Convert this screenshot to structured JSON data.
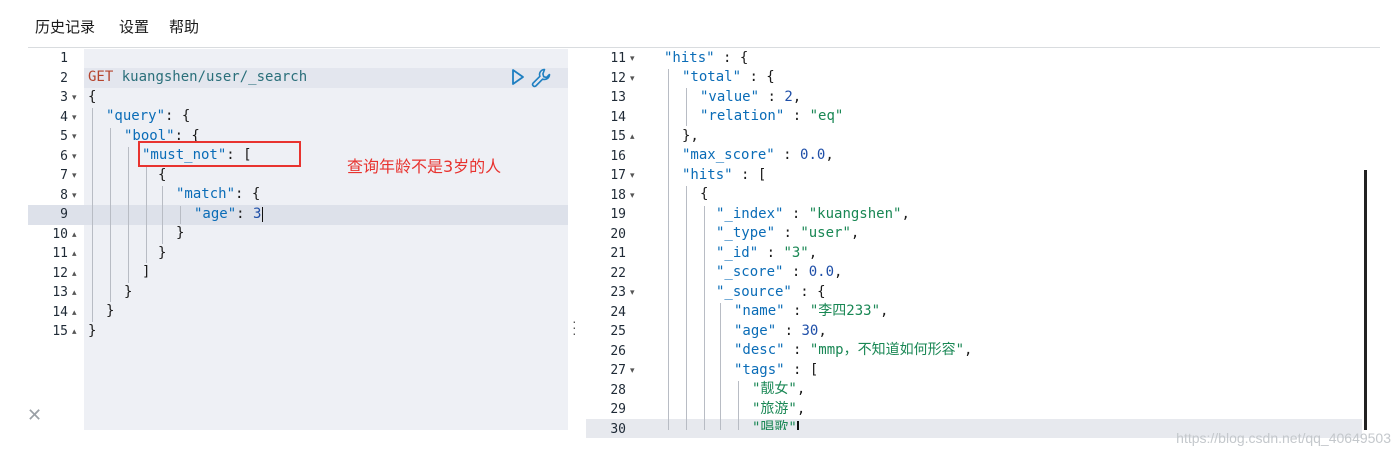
{
  "menu": {
    "history": "历史记录",
    "settings": "设置",
    "help": "帮助"
  },
  "request": {
    "lines": [
      {
        "n": "1",
        "fold": ""
      },
      {
        "n": "2",
        "fold": ""
      },
      {
        "n": "3",
        "fold": "▾"
      },
      {
        "n": "4",
        "fold": "▾"
      },
      {
        "n": "5",
        "fold": "▾"
      },
      {
        "n": "6",
        "fold": "▾"
      },
      {
        "n": "7",
        "fold": "▾"
      },
      {
        "n": "8",
        "fold": "▾"
      },
      {
        "n": "9",
        "fold": ""
      },
      {
        "n": "10",
        "fold": "▴"
      },
      {
        "n": "11",
        "fold": "▴"
      },
      {
        "n": "12",
        "fold": "▴"
      },
      {
        "n": "13",
        "fold": "▴"
      },
      {
        "n": "14",
        "fold": "▴"
      },
      {
        "n": "15",
        "fold": "▴"
      }
    ],
    "method": "GET",
    "path": "kuangshen/user/_search",
    "t3": "{",
    "t4_key": "\"query\"",
    "t4_rest": ": {",
    "t5_key": "\"bool\"",
    "t5_rest": ": {",
    "t6_key": "\"must_not\"",
    "t6_rest": ": [",
    "t7": "{",
    "t8_key": "\"match\"",
    "t8_rest": ": {",
    "t9_key": "\"age\"",
    "t9_sep": ": ",
    "t9_val": "3",
    "t10": "}",
    "t11": "}",
    "t12": "]",
    "t13": "}",
    "t14": "}",
    "t15": "}"
  },
  "annotation": "查询年龄不是3岁的人",
  "response": {
    "lines": [
      {
        "n": "11",
        "fold": "▾"
      },
      {
        "n": "12",
        "fold": "▾"
      },
      {
        "n": "13",
        "fold": ""
      },
      {
        "n": "14",
        "fold": ""
      },
      {
        "n": "15",
        "fold": "▴"
      },
      {
        "n": "16",
        "fold": ""
      },
      {
        "n": "17",
        "fold": "▾"
      },
      {
        "n": "18",
        "fold": "▾"
      },
      {
        "n": "19",
        "fold": ""
      },
      {
        "n": "20",
        "fold": ""
      },
      {
        "n": "21",
        "fold": ""
      },
      {
        "n": "22",
        "fold": ""
      },
      {
        "n": "23",
        "fold": "▾"
      },
      {
        "n": "24",
        "fold": ""
      },
      {
        "n": "25",
        "fold": ""
      },
      {
        "n": "26",
        "fold": ""
      },
      {
        "n": "27",
        "fold": "▾"
      },
      {
        "n": "28",
        "fold": ""
      },
      {
        "n": "29",
        "fold": ""
      },
      {
        "n": "30",
        "fold": ""
      }
    ],
    "r11_key": "\"hits\"",
    "r11_rest": " : {",
    "r12_key": "\"total\"",
    "r12_rest": " : {",
    "r13_key": "\"value\"",
    "r13_sep": " : ",
    "r13_val": "2",
    "r13_end": ",",
    "r14_key": "\"relation\"",
    "r14_sep": " : ",
    "r14_val": "\"eq\"",
    "r15": "},",
    "r16_key": "\"max_score\"",
    "r16_sep": " : ",
    "r16_val": "0.0",
    "r16_end": ",",
    "r17_key": "\"hits\"",
    "r17_rest": " : [",
    "r18": "{",
    "r19_key": "\"_index\"",
    "r19_sep": " : ",
    "r19_val": "\"kuangshen\"",
    "r19_end": ",",
    "r20_key": "\"_type\"",
    "r20_sep": " : ",
    "r20_val": "\"user\"",
    "r20_end": ",",
    "r21_key": "\"_id\"",
    "r21_sep": " : ",
    "r21_val": "\"3\"",
    "r21_end": ",",
    "r22_key": "\"_score\"",
    "r22_sep": " : ",
    "r22_val": "0.0",
    "r22_end": ",",
    "r23_key": "\"_source\"",
    "r23_rest": " : {",
    "r24_key": "\"name\"",
    "r24_sep": " : ",
    "r24_val": "\"李四233\"",
    "r24_end": ",",
    "r25_key": "\"age\"",
    "r25_sep": " : ",
    "r25_val": "30",
    "r25_end": ",",
    "r26_key": "\"desc\"",
    "r26_sep": " : ",
    "r26_val": "\"mmp，不知道如何形容\"",
    "r26_end": ",",
    "r27_key": "\"tags\"",
    "r27_rest": " : [",
    "r28_val": "\"靓女\"",
    "r28_end": ",",
    "r29_val": "\"旅游\"",
    "r29_end": ",",
    "r30_val": "\"唱歌\""
  },
  "watermark": "https://blog.csdn.net/qq_40649503",
  "icons": {
    "run": "play-icon",
    "settings": "wrench-icon",
    "close": "close-icon"
  },
  "colors": {
    "annotation": "#e8332f",
    "key": "#0a6cb7",
    "string": "#198754",
    "method": "#b5442e"
  }
}
